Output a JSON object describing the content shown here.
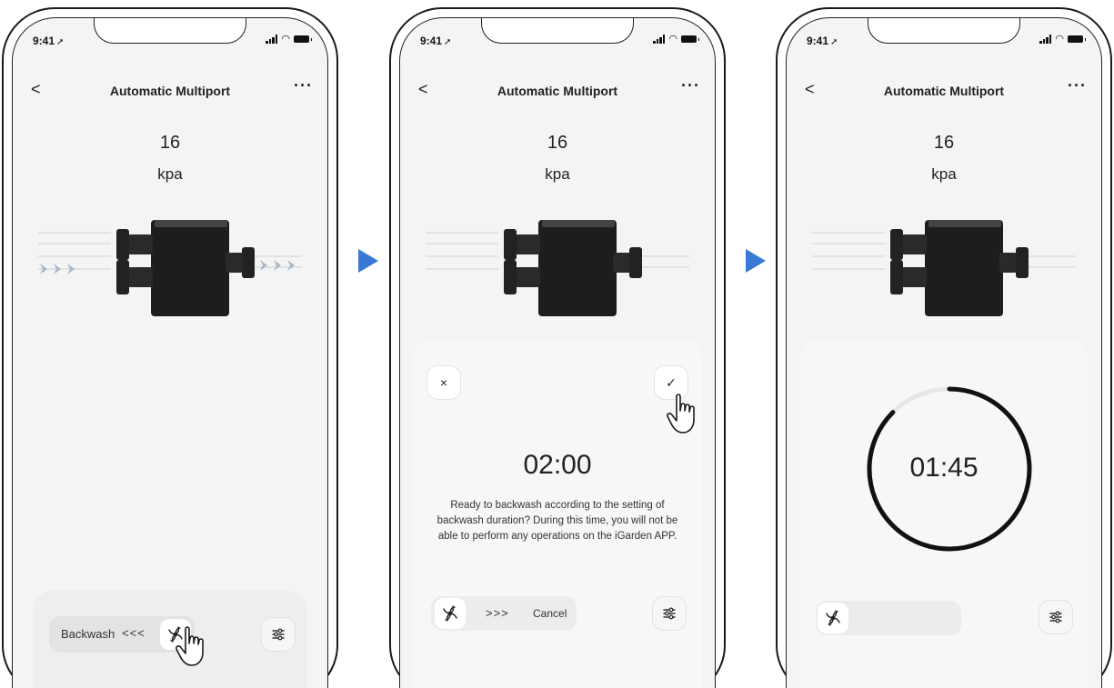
{
  "status": {
    "time": "9:41"
  },
  "nav": {
    "back": "<",
    "title": "Automatic Multiport",
    "more": "···"
  },
  "pressure": {
    "value": "16",
    "unit": "kpa"
  },
  "screen1": {
    "mode_label": "Backwash",
    "chevrons": "<<<"
  },
  "screen2": {
    "cancel_icon": "×",
    "confirm_icon": "✓",
    "countdown": "02:00",
    "message": "Ready to backwash according to the setting of backwash duration? During this time, you will not be able to perform any operations on the iGarden APP.",
    "chevrons": ">>>",
    "cancel_label": "Cancel"
  },
  "screen3": {
    "countdown": "01:45",
    "progress_remaining": 0.875
  },
  "icons": {
    "fan": "fan-icon",
    "settings": "sliders-icon",
    "hand": "pointing-hand-icon",
    "step": "play-triangle-icon"
  },
  "colors": {
    "step_arrow": "#3a78d6",
    "ring": "#111111",
    "ring_track": "#e6e6e6"
  }
}
